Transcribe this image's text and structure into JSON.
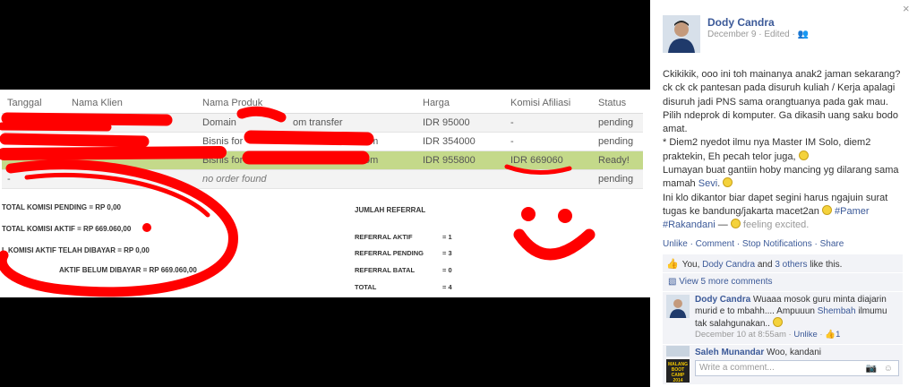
{
  "table": {
    "headers": [
      "Tanggal",
      "Nama Klien",
      "Nama Produk",
      "Harga",
      "Komisi Afiliasi",
      "Status"
    ],
    "rows": [
      {
        "produk": "Domain ",
        "produk_tail": "om transfer",
        "harga": "IDR 95000",
        "komisi": "-",
        "status": "pending"
      },
      {
        "produk": "Bisnis for ",
        "produk_tail": "u.com",
        "harga": "IDR 354000",
        "komisi": "-",
        "status": "pending"
      },
      {
        "produk": "Bisnis for ",
        "produk_tail": "u.com",
        "harga": "IDR 955800",
        "komisi": "IDR 669060",
        "status": "Ready!"
      },
      {
        "tanggal": "-",
        "produk": "no order found",
        "status": "pending"
      }
    ]
  },
  "summary": {
    "pending": "TOTAL KOMISI PENDING = RP 0,00",
    "aktif": "TOTAL KOMISI AKTIF = RP 669.060,00",
    "dibayar": "L KOMISI AKTIF TELAH DIBAYAR = RP 0,00",
    "belum": "AKTIF BELUM DIBAYAR = RP 669.060,00"
  },
  "referral": {
    "title": "JUMLAH REFERRAL",
    "rows": [
      {
        "label": "REFERRAL AKTIF",
        "value": "= 1"
      },
      {
        "label": "REFERRAL PENDING",
        "value": "= 3"
      },
      {
        "label": "REFERRAL BATAL",
        "value": "= 0"
      },
      {
        "label": "TOTAL",
        "value": "= 4"
      }
    ]
  },
  "post": {
    "close": "×",
    "author": "Dody Candra",
    "date": "December 9",
    "edited": "· Edited ·",
    "p1": "Ckikikik, ooo ini toh mainanya anak2 jaman sekarang? ck ck ck pantesan pada disuruh kuliah / Kerja apalagi disuruh jadi PNS sama orangtuanya pada gak mau. Pilih ndeprok di komputer. Ga dikasih uang saku bodo amat.",
    "p2": "* Diem2 nyedot ilmu nya Master IM Solo, diem2 praktekin, Eh pecah telor juga,",
    "p3a": "Lumayan buat gantiin hoby mancing yg dilarang sama mamah ",
    "sevi": "Sevi",
    "p4a": "Ini klo dikantor biar dapet segini harus ngajuin surat tugas ke bandung/jakarta macet2an",
    "tag1": "#Pamer",
    "tag2": "#Rakandani",
    "dash": " — ",
    "feeling": "feeling excited.",
    "actions": "Unlike · Comment · Stop Notifications · Share",
    "likes_prefix": "You, ",
    "likes_name": "Dody Candra",
    "likes_mid": " and ",
    "likes_others": "3 others",
    "likes_suffix": " like this.",
    "more_comments": "View 5 more comments",
    "c1_name": "Dody Candra",
    "c1_text": " Wuaaa mosok guru minta diajarin murid e to mbahh.... Ampuuun",
    "c1_tag": "Shembah",
    "c1_text2": " ilmumu tak salahgunakan..",
    "c1_date": "December 10 at 8:55am",
    "c1_unlike": "Unlike",
    "c1_likes": "1",
    "c2_name": "Saleh Munandar",
    "c2_text": " Woo, kandani",
    "composer_avatar": "MALANG BOOT CAMP 2014",
    "composer_placeholder": "Write a comment..."
  }
}
